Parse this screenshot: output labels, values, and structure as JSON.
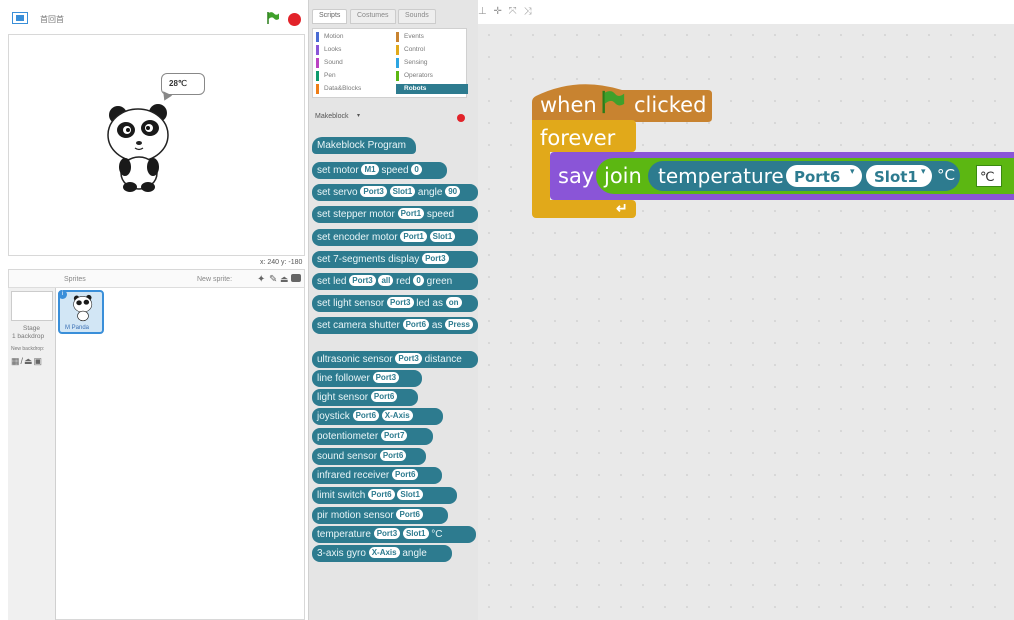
{
  "header": {
    "project_title": "首回首"
  },
  "stage": {
    "speech": "28℃",
    "coords": "x: 240  y: -180"
  },
  "sprites_pane": {
    "title": "Sprites",
    "new_sprite_label": "New sprite:",
    "stage_label_1": "Stage",
    "stage_label_2": "1 backdrop",
    "new_backdrop_label": "New backdrop:",
    "sprite_name": "M Panda"
  },
  "palette": {
    "tabs": [
      "Scripts",
      "Costumes",
      "Sounds"
    ],
    "categories_left": [
      {
        "label": "Motion",
        "color": "#4a6cd4"
      },
      {
        "label": "Looks",
        "color": "#8a55d7"
      },
      {
        "label": "Sound",
        "color": "#bb42c3"
      },
      {
        "label": "Pen",
        "color": "#0e9a6c"
      },
      {
        "label": "Data&Blocks",
        "color": "#ee7d16"
      }
    ],
    "categories_right": [
      {
        "label": "Events",
        "color": "#c88330"
      },
      {
        "label": "Control",
        "color": "#e1a91a"
      },
      {
        "label": "Sensing",
        "color": "#2ca5e2"
      },
      {
        "label": "Operators",
        "color": "#5cb712"
      },
      {
        "label": "Robots",
        "color": "#2d7b8f"
      }
    ],
    "extension": "Makeblock",
    "program_block": "Makeblock Program"
  },
  "script": {
    "when": "when",
    "clicked": "clicked",
    "forever": "forever",
    "say": "say",
    "join": "join",
    "temperature": "temperature",
    "port": "Port6",
    "slot": "Slot1",
    "unit": "°C",
    "join_text": "℃"
  }
}
